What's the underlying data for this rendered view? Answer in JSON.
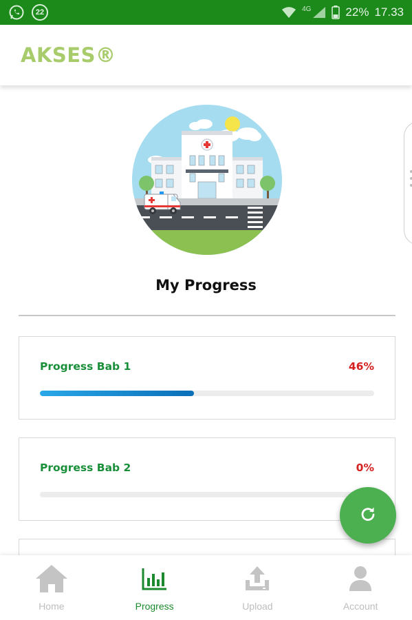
{
  "status_bar": {
    "notification_count": "22",
    "network_label": "4G",
    "battery": "22%",
    "time": "17.33",
    "icons": [
      "whatsapp-icon",
      "wifi-icon",
      "signal-icon",
      "battery-icon"
    ]
  },
  "header": {
    "title": "AKSES®"
  },
  "main": {
    "hero_image": "hospital-illustration",
    "section_title": "My Progress",
    "progress_items": [
      {
        "label": "Progress Bab 1",
        "percent_text": "46%",
        "value": 46
      },
      {
        "label": "Progress Bab 2",
        "percent_text": "0%",
        "value": 0
      }
    ],
    "refresh_button_icon": "refresh-icon"
  },
  "bottom_nav": {
    "items": [
      {
        "label": "Home",
        "icon": "home-icon",
        "active": false
      },
      {
        "label": "Progress",
        "icon": "bar-chart-icon",
        "active": true
      },
      {
        "label": "Upload",
        "icon": "upload-icon",
        "active": false
      },
      {
        "label": "Account",
        "icon": "account-icon",
        "active": false
      }
    ]
  },
  "colors": {
    "status_bar": "#1b8a1b",
    "brand": "#a8cc6c",
    "progress_label": "#1a8f3a",
    "percent": "#d42020",
    "progress_fill": "#1e8fd6",
    "fab": "#4caf50",
    "nav_active": "#1b8a2e",
    "nav_inactive": "#bdbdbd"
  }
}
